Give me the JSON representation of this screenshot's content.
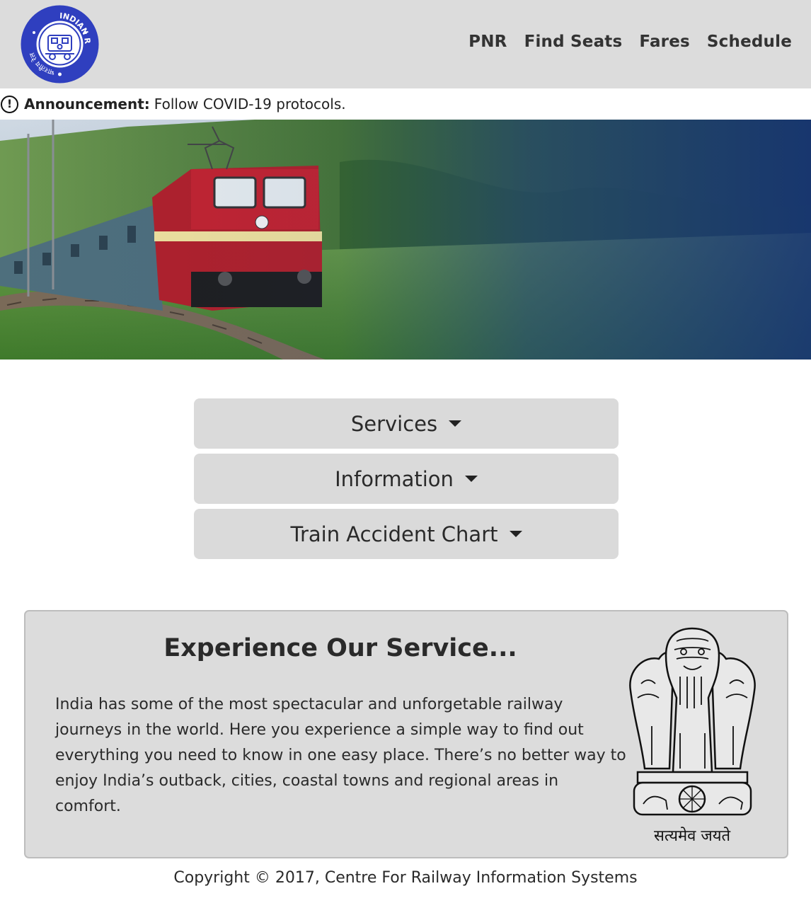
{
  "header": {
    "logo_text": "INDIAN RAILWAYS",
    "logo_text_hindi": "भारतीय रेल",
    "nav": [
      "PNR",
      "Find Seats",
      "Fares",
      "Schedule"
    ]
  },
  "announcement": {
    "label": "Announcement:",
    "text": "Follow COVID-19 protocols."
  },
  "menus": [
    {
      "label": "Services"
    },
    {
      "label": "Information"
    },
    {
      "label": "Train Accident Chart"
    }
  ],
  "card": {
    "title": "Experience Our Service...",
    "body": "India has some of the most spectacular and unforgetable railway journeys in the world. Here you experience a simple way to find out everything you need to know in one easy place. There’s no better way to enjoy India’s outback, cities, coastal towns and regional areas in comfort.",
    "emblem_motto": "सत्यमेव जयते"
  },
  "footer": {
    "copyright": "Copyright © 2017, Centre For Railway Information Systems"
  },
  "colors": {
    "header_bg": "#dcdcdc",
    "logo_blue": "#2f3fbf",
    "button_bg": "#dadada",
    "hero_overlay": "#1d3a86"
  }
}
